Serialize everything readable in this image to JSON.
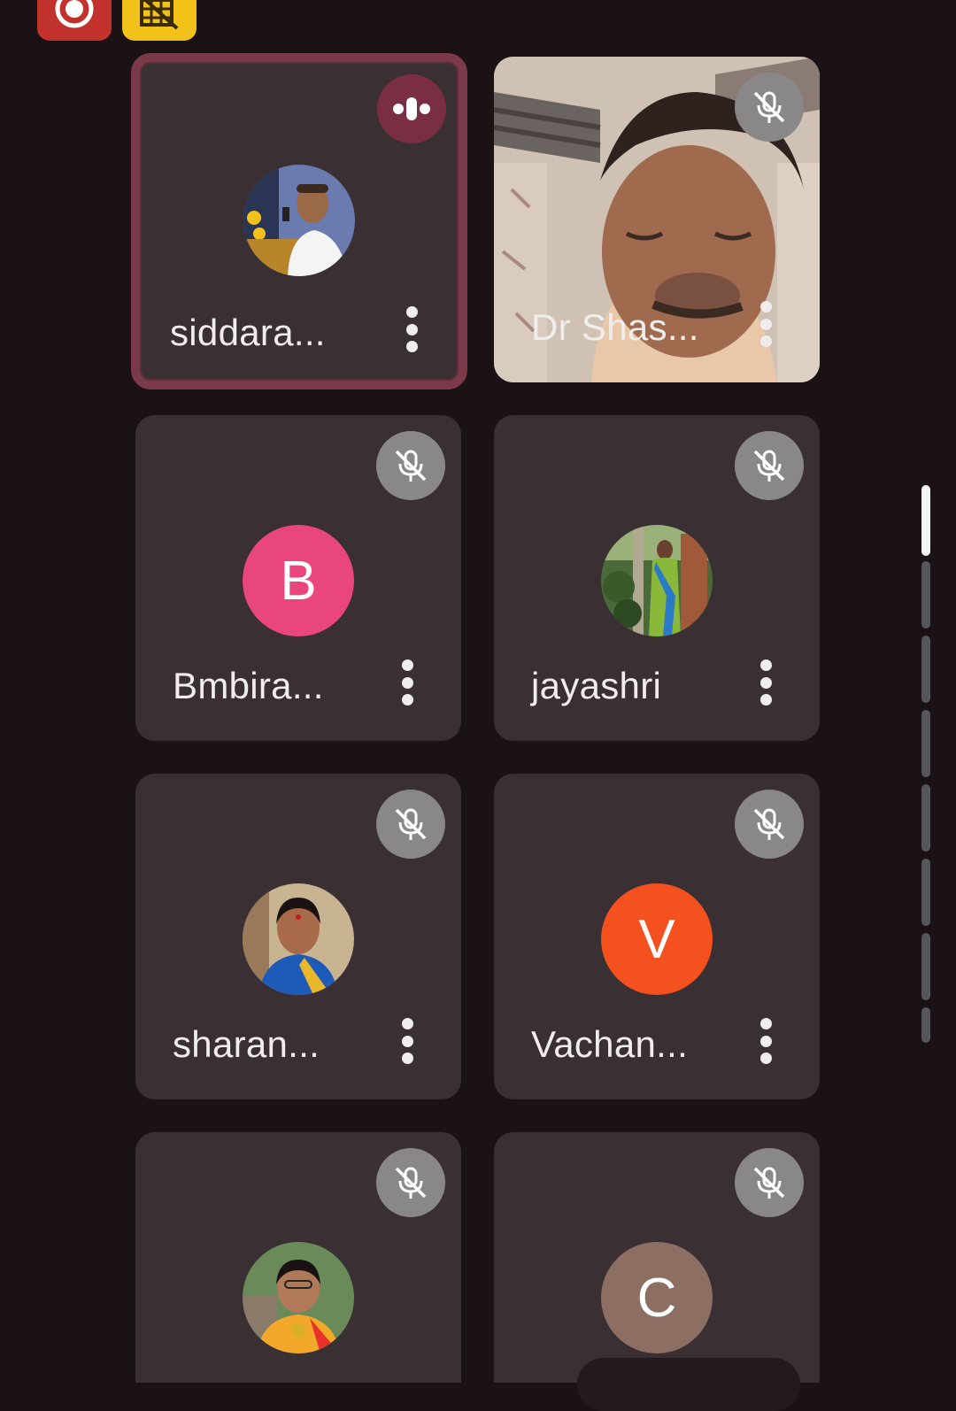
{
  "colors": {
    "background": "#1a1214",
    "tile": "#3a3033",
    "active_border": "#7a3a4a",
    "mic_button": "#8a8789",
    "speaking_indicator": "#7a2e44"
  },
  "top_badges": [
    {
      "icon": "record-icon",
      "color": "#c0322b"
    },
    {
      "icon": "camera-off-grid-icon",
      "color": "#f2c21a"
    }
  ],
  "participants": [
    {
      "name": "siddara...",
      "status": "speaking",
      "avatar": "photo"
    },
    {
      "name": "Dr Shas...",
      "status": "muted",
      "avatar": "video"
    },
    {
      "name": "Bmbira...",
      "status": "muted",
      "avatar": "letter",
      "letter": "B",
      "avatar_color": "#e8467c"
    },
    {
      "name": "jayashri",
      "status": "muted",
      "avatar": "photo"
    },
    {
      "name": "sharan...",
      "status": "muted",
      "avatar": "photo"
    },
    {
      "name": "Vachan...",
      "status": "muted",
      "avatar": "letter",
      "letter": "V",
      "avatar_color": "#f4511e"
    },
    {
      "name": "",
      "status": "muted",
      "avatar": "photo"
    },
    {
      "name": "",
      "status": "muted",
      "avatar": "letter",
      "letter": "C",
      "avatar_color": "#8d6e63"
    }
  ],
  "scrollbar": {
    "segments": 8,
    "active_segment": 1
  }
}
